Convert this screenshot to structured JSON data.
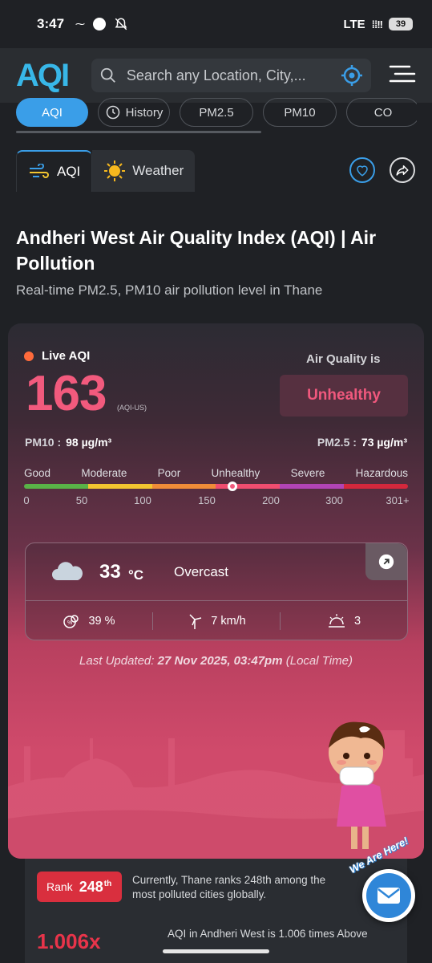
{
  "status_bar": {
    "time": "3:47",
    "network": "LTE",
    "battery": "39"
  },
  "header": {
    "logo": "AQI",
    "search_placeholder": "Search any Location, City,..."
  },
  "tabs": [
    {
      "label": "AQI",
      "active": true
    },
    {
      "label": "History",
      "active": false
    },
    {
      "label": "PM2.5",
      "active": false
    },
    {
      "label": "PM10",
      "active": false
    },
    {
      "label": "CO",
      "active": false
    }
  ],
  "segments": {
    "aqi_label": "AQI",
    "weather_label": "Weather"
  },
  "page": {
    "title": "Andheri West Air Quality Index (AQI) | Air Pollution",
    "subtitle": "Real-time PM2.5, PM10 air pollution level in Thane"
  },
  "aqi": {
    "live_label": "Live AQI",
    "value": "163",
    "unit": "(AQI-US)",
    "air_quality_label": "Air Quality is",
    "status": "Unhealthy",
    "pm10_label": "PM10 :",
    "pm10_value": "98 µg/m³",
    "pm25_label": "PM2.5 :",
    "pm25_value": "73 µg/m³",
    "scale_labels": [
      "Good",
      "Moderate",
      "Poor",
      "Unhealthy",
      "Severe",
      "Hazardous"
    ],
    "scale_colors": [
      "#59b247",
      "#f2c530",
      "#ef8c38",
      "#ef4d6f",
      "#b144b5",
      "#d4283c"
    ],
    "scale_ticks": [
      "0",
      "50",
      "100",
      "150",
      "200",
      "300",
      "301+"
    ],
    "marker_fraction": 0.543
  },
  "weather": {
    "temperature": "33",
    "temp_unit": "°C",
    "condition": "Overcast",
    "humidity": "39 %",
    "wind": "7 km/h",
    "uv": "3"
  },
  "last_updated": {
    "prefix": "Last Updated:",
    "datetime": "27 Nov 2025, 03:47pm",
    "suffix": "(Local Time)"
  },
  "rank": {
    "label": "Rank",
    "value": "248",
    "suffix": "th",
    "text": "Currently, Thane ranks 248th among the most polluted cities globally."
  },
  "compare": {
    "value": "1.006x",
    "text": "AQI in Andheri West is 1.006 times Above"
  },
  "contact": {
    "tagline": "We Are Here!"
  }
}
